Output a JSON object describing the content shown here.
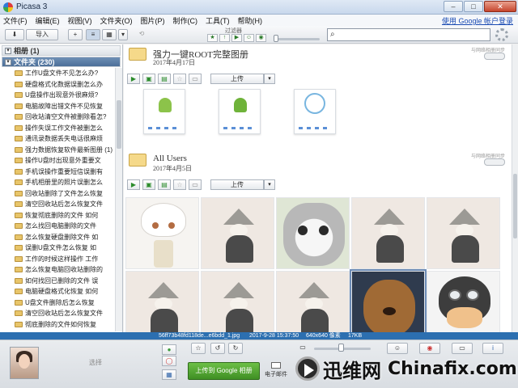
{
  "window": {
    "title": "Picasa 3"
  },
  "menu": [
    "文件(F)",
    "编辑(E)",
    "视图(V)",
    "文件夹(O)",
    "图片(P)",
    "制作(C)",
    "工具(T)",
    "帮助(H)"
  ],
  "account_link": "使用 Google 帐户登录",
  "toolbar": {
    "import": "导入",
    "filter_label": "过滤器",
    "search_placeholder": ""
  },
  "left": {
    "albums_header": "相册 (1)",
    "folders_header": "文件夹 (230)",
    "folders": [
      "工作U盘文件不见怎么办?",
      "硬盘格式化数据误删怎么办",
      "U盘操作出现意外很麻烦?",
      "电脑故障出错文件不见恢复",
      "回收站清空文件被删除看怎?",
      "操作失误工作文件被删怎么",
      "通讯录数据丢失电话很麻烦",
      "强力数据恢复软件最新图册 (1)",
      "操作U盘时出现意外重要文",
      "手机误操作重要短信误删有",
      "手机相册里的照片误删怎么",
      "回收站删除了文件怎么恢复",
      "清空回收站后怎么恢复文件",
      "恢复彻底删除的文件 如何",
      "怎么找回电脑删除的文件",
      "怎么恢复硬盘删除文件 如",
      "误删U盘文件怎么恢复 如",
      "工作的时候这样操作 工作",
      "怎么恢复电脑回收站删除的",
      "如何找回已删除的文件 误",
      "电脑硬盘格式化恢复 如何",
      "U盘文件删除后怎么恢复",
      "清空回收站后怎么恢复文件",
      "彻底删除的文件如何恢复"
    ]
  },
  "albums": [
    {
      "title": "强力一键ROOT完整图册",
      "date": "2017年4月17日",
      "sync": "与网络相册同步",
      "upload": "上传"
    },
    {
      "title": "All Users",
      "date": "2017年4月5日",
      "sync": "与网络相册同步",
      "upload": "上传"
    }
  ],
  "status": {
    "filename": "56ff73b48fd118de...e6bdd_1.jpg",
    "date": "2017-9-28 15:37:50",
    "dimensions": "640x640 像素",
    "size": "17KB"
  },
  "tray": {
    "select": "选择",
    "upload_google": "上传到 Google 相册",
    "email": "电子邮件"
  },
  "watermark": {
    "cn": "迅维网",
    "en": "Chinafix.com"
  }
}
